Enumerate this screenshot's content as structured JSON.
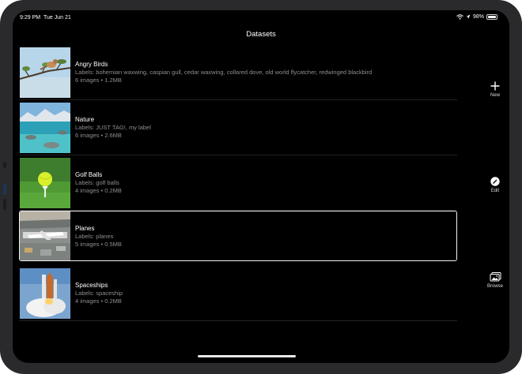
{
  "status": {
    "time": "9:29 PM",
    "date": "Tue Jun 21",
    "battery": "98%"
  },
  "page": {
    "title": "Datasets"
  },
  "datasets": [
    {
      "name": "Angry Birds",
      "labels": "Labels: bohemian waxwing, caspian gull, cedar waxwing, collared dove, old world flycatcher, redwinged blackbird",
      "meta": "6 images • 1.2MB"
    },
    {
      "name": "Nature",
      "labels": "Labels: JUST TAG!, my label",
      "meta": "6 images • 2.6MB"
    },
    {
      "name": "Golf Balls",
      "labels": "Labels: golf balls",
      "meta": "4 images • 0.2MB"
    },
    {
      "name": "Planes",
      "labels": "Labels: planes",
      "meta": "5 images • 0.5MB"
    },
    {
      "name": "Spaceships",
      "labels": "Labels: spaceship",
      "meta": "4 images • 0.2MB"
    }
  ],
  "actions": {
    "new": "New",
    "edit": "Edit",
    "browse": "Browse"
  },
  "colors": {
    "background": "#000000",
    "selection_border": "#f0f0f0",
    "secondary_text": "#8e8e93"
  }
}
